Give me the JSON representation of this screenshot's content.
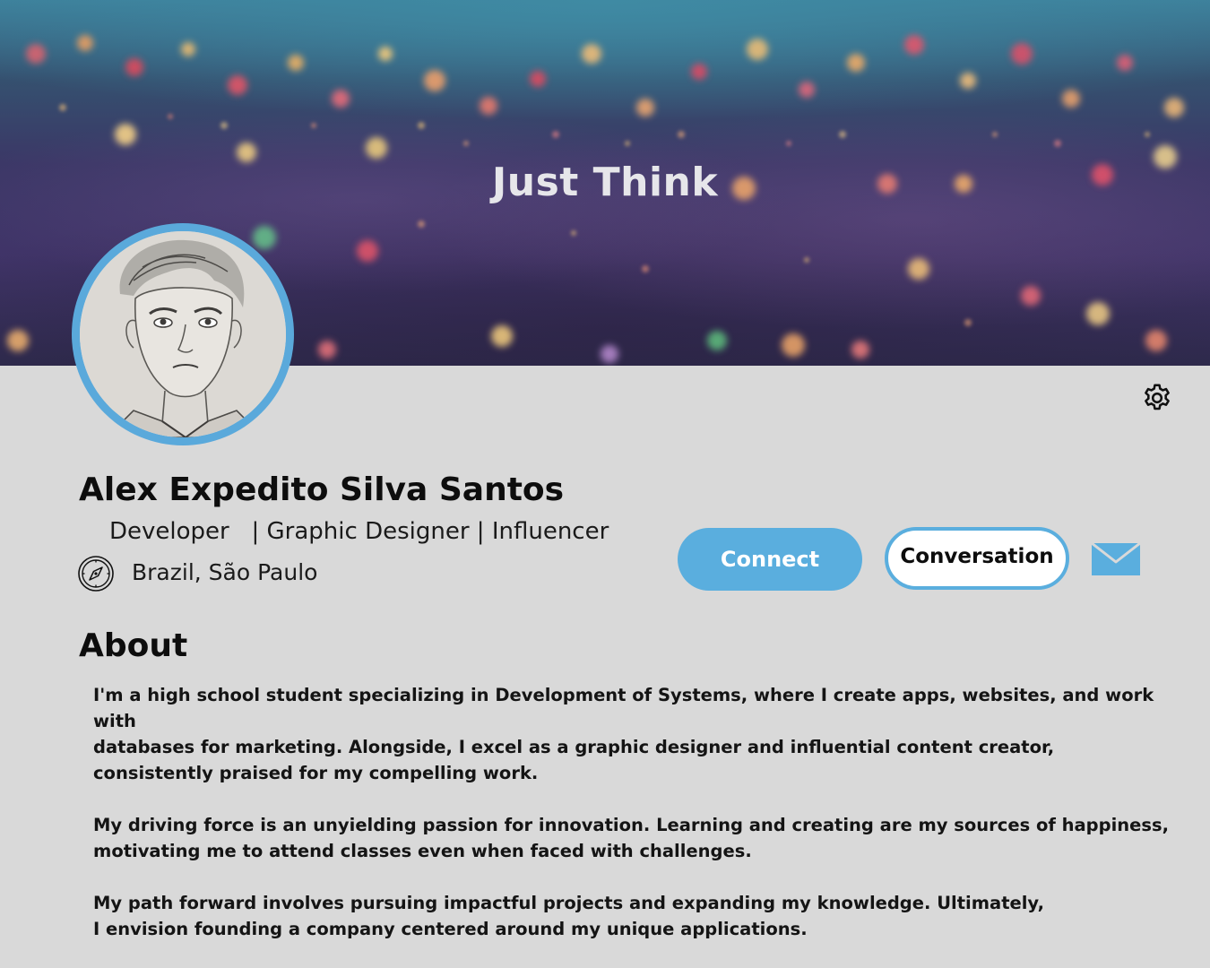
{
  "cover": {
    "title": "Just Think"
  },
  "profile": {
    "name": "Alex Expedito Silva Santos",
    "headline": "Developer   | Graphic Designer | Influencer",
    "location": "Brazil, São Paulo"
  },
  "actions": {
    "connect_label": "Connect",
    "conversation_label": "Conversation"
  },
  "about": {
    "title": "About",
    "paragraphs": [
      "I'm a high school student specializing in Development of Systems, where I create apps, websites, and work with\ndatabases for marketing. Alongside, I excel as a graphic designer and influential content creator,\nconsistently praised for my compelling work.",
      "My driving force is an unyielding passion for innovation. Learning and creating are my sources of happiness,\n motivating me to attend classes even when faced with challenges.",
      "My path forward involves pursuing impactful projects and expanding my knowledge. Ultimately,\nI envision founding a company centered around my unique applications."
    ]
  },
  "colors": {
    "accent": "#5aaede",
    "page_background": "#d9d9d9",
    "text": "#0d0d0d"
  },
  "icons": {
    "settings": "gear-icon",
    "location": "compass-icon",
    "message": "envelope-icon"
  }
}
